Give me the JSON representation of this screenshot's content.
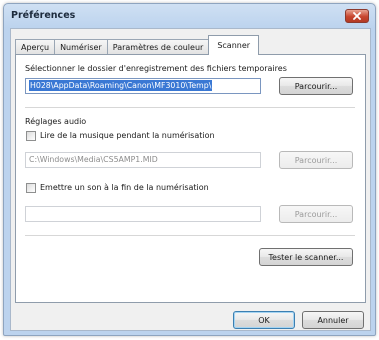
{
  "window": {
    "title": "Préférences"
  },
  "tabs": [
    {
      "label": "Aperçu",
      "active": false
    },
    {
      "label": "Numériser",
      "active": false
    },
    {
      "label": "Paramètres de couleur",
      "active": false
    },
    {
      "label": "Scanner",
      "active": true
    }
  ],
  "temp_folder": {
    "label": "Sélectionner le dossier d'enregistrement des fichiers temporaires",
    "path": "H028\\AppData\\Roaming\\Canon\\MF3010\\Temp\\",
    "browse_label": "Parcourir..."
  },
  "audio": {
    "heading": "Réglages audio",
    "play_music_label": "Lire de la musique pendant la numérisation",
    "play_music_checked": false,
    "music_path": "C:\\Windows\\Media\\CS5AMP1.MID",
    "music_browse_label": "Parcourir...",
    "beep_label": "Emettre un son à la fin de la numérisation",
    "beep_checked": false,
    "beep_path": "",
    "beep_browse_label": "Parcourir..."
  },
  "test_scanner_label": "Tester le scanner...",
  "footer": {
    "ok_label": "OK",
    "cancel_label": "Annuler"
  },
  "colors": {
    "selection": "#3a78d4",
    "close_button": "#c8452e",
    "frame": "#bcd3ee"
  }
}
